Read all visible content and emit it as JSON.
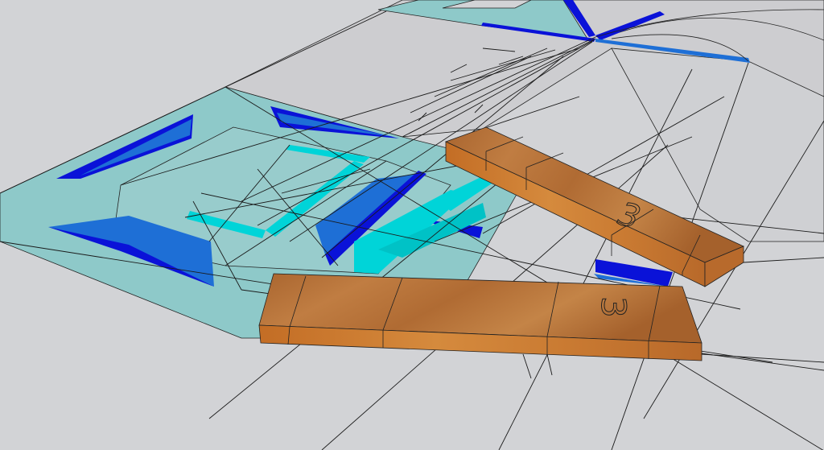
{
  "scene": {
    "background_color": "#d2d3d6",
    "ground_color": "#d5d6d9",
    "far_panel_color": "#cfcfd2",
    "line_color": "#1a1a1a",
    "colors": {
      "teal_surface": "#8ec9c9",
      "cyan_strip": "#00d4d8",
      "deep_blue": "#0a12d8",
      "mid_blue": "#1e6fd6",
      "wood_top": "#b8743a",
      "wood_side": "#c9752d",
      "wood_dark": "#9a5a28"
    },
    "board_labels": {
      "board_back": "3",
      "board_front": "3"
    }
  }
}
